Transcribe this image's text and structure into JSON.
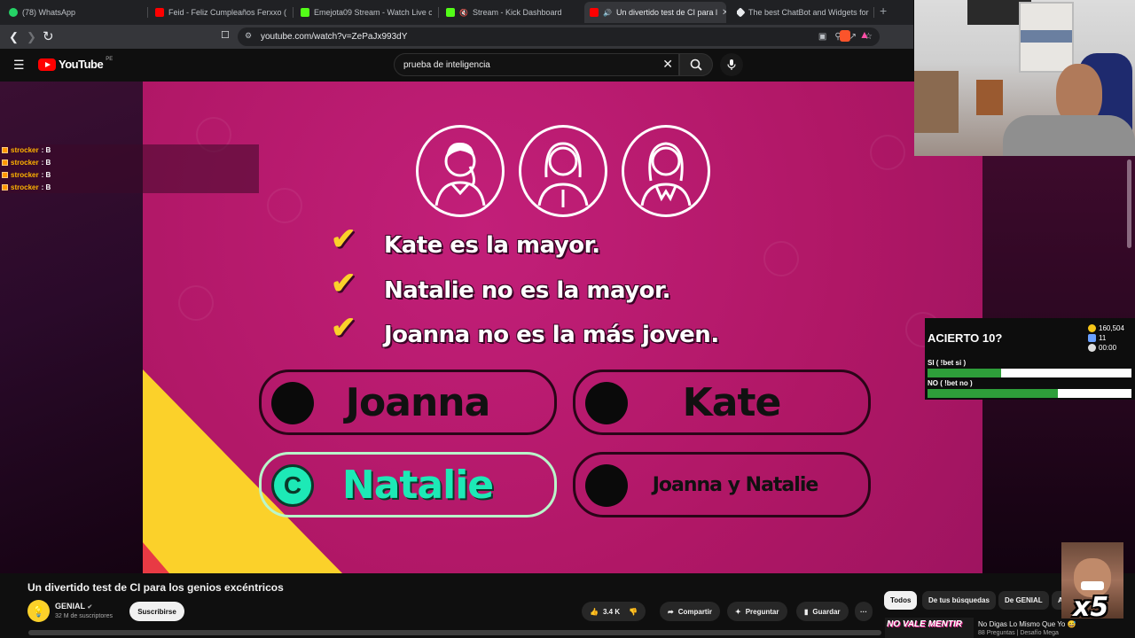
{
  "browser": {
    "tabs": [
      {
        "label": "(78) WhatsApp",
        "color": "#25d366"
      },
      {
        "label": "Feid - Feliz Cumpleaños Ferxxo (Offic",
        "color": "#ff0000"
      },
      {
        "label": "Emejota09 Stream - Watch Live on Ki",
        "color": "#53fc18"
      },
      {
        "label": "Stream - Kick Dashboard",
        "color": "#53fc18"
      },
      {
        "label": "Un divertido test de CI para l",
        "color": "#ff0000"
      },
      {
        "label": "The best ChatBot and Widgets for Ki",
        "color": "#e8eaed"
      }
    ],
    "url": "youtube.com/watch?v=ZePaJx993dY"
  },
  "youtube": {
    "logo_text": "YouTube",
    "country": "PE",
    "search_query": "prueba de inteligencia"
  },
  "chat": {
    "lines": [
      {
        "user": "strocker",
        "message": ": B"
      },
      {
        "user": "strocker",
        "message": ": B"
      },
      {
        "user": "strocker",
        "message": ": B"
      },
      {
        "user": "strocker",
        "message": ": B"
      }
    ]
  },
  "quiz": {
    "statements": [
      "Kate es la mayor.",
      "Natalie no es la mayor.",
      "Joanna no es la más joven."
    ],
    "options": [
      {
        "label": "Joanna",
        "correct": false
      },
      {
        "label": "Kate",
        "correct": false
      },
      {
        "label": "Natalie",
        "correct": true,
        "marker": "C"
      },
      {
        "label": "Joanna y Natalie",
        "correct": false
      }
    ]
  },
  "bet": {
    "title": "ACIERTO 10?",
    "coins": "160,504",
    "users": "11",
    "timer": "00:00",
    "option_yes": "SI ( !bet si )",
    "option_no": "NO ( !bet no )",
    "yes_fraction": 0.36,
    "no_fraction": 0.64
  },
  "meme": {
    "text": "x5"
  },
  "video": {
    "title": "Un divertido test de CI para los genios excéntricos",
    "channel": "GENIAL",
    "subscribers": "32 M de suscriptores",
    "subscribe_label": "Suscribirse",
    "likes": "3.4 K",
    "share_label": "Compartir",
    "ask_label": "Preguntar",
    "save_label": "Guardar",
    "more_label": "···"
  },
  "sidebar_chips": [
    "Todos",
    "De tus búsquedas",
    "De GENIAL",
    "A"
  ],
  "recommendation": {
    "thumb_text": "NO VALE MENTIR",
    "title": "No Digas Lo Mismo Que Yo 😅",
    "subtitle": "88 Preguntas | Desafío Mega"
  }
}
